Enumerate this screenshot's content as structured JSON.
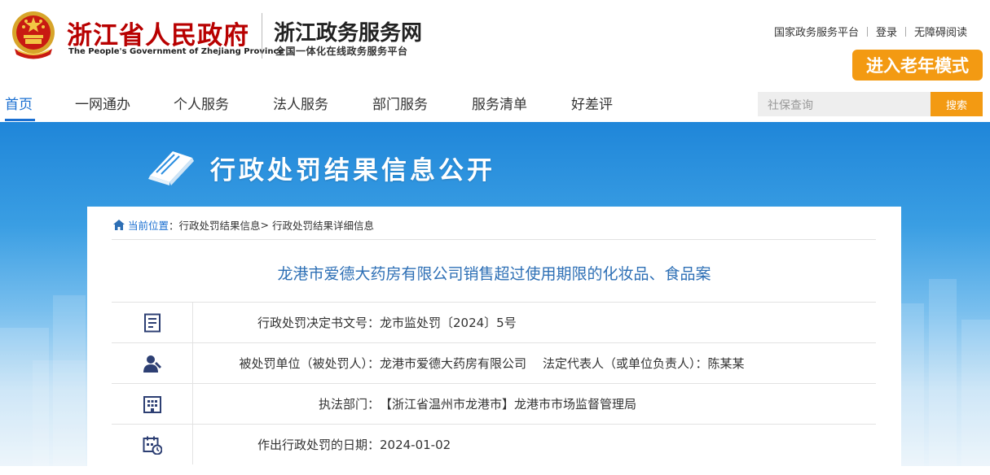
{
  "header": {
    "gov_title": "浙江省人民政府",
    "gov_subtitle": "The People's Government of Zhejiang Province",
    "service_title": "浙江政务服务网",
    "service_subtitle": "全国一体化在线政务服务平台",
    "top_links": [
      "国家政务服务平台",
      "登录",
      "无障碍阅读"
    ],
    "elder_mode": "进入老年模式"
  },
  "nav": {
    "items": [
      "首页",
      "一网通办",
      "个人服务",
      "法人服务",
      "部门服务",
      "服务清单",
      "好差评"
    ],
    "active_index": 0,
    "search_placeholder": "社保查询",
    "search_button": "搜索"
  },
  "banner": {
    "title": "行政处罚结果信息公开"
  },
  "breadcrumb": {
    "current_label": "当前位置",
    "colon": "：",
    "items": [
      "行政处罚结果信息",
      "行政处罚结果详细信息"
    ],
    "sep": ">"
  },
  "case": {
    "title": "龙港市爱德大药房有限公司销售超过使用期限的化妆品、食品案",
    "rows": [
      {
        "icon": "document-icon",
        "label": "行政处罚决定书文号：",
        "value": "龙市监处罚〔2024〕5号"
      },
      {
        "icon": "person-icon",
        "label": "被处罚单位（被处罚人）：",
        "value": "龙港市爱德大药房有限公司",
        "extra_label": "法定代表人（或单位负责人）：",
        "extra_value": "陈某某"
      },
      {
        "icon": "building-icon",
        "label": "执法部门：",
        "value": "【浙江省温州市龙港市】龙港市市场监督管理局"
      },
      {
        "icon": "calendar-icon",
        "label": "作出行政处罚的日期：",
        "value": "2024-01-02"
      }
    ]
  },
  "colors": {
    "gov_red": "#b80000",
    "accent_orange": "#f39a12",
    "link_blue": "#1a6fd1",
    "title_blue": "#2d6fb5"
  }
}
